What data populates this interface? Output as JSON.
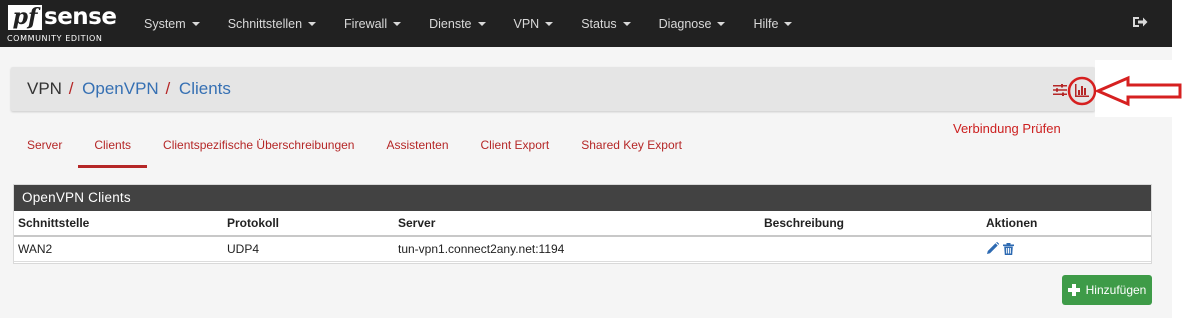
{
  "brand": {
    "logo_pf": "pf",
    "logo_sense": "sense",
    "edition": "COMMUNITY EDITION"
  },
  "nav": {
    "items": [
      {
        "label": "System"
      },
      {
        "label": "Schnittstellen"
      },
      {
        "label": "Firewall"
      },
      {
        "label": "Dienste"
      },
      {
        "label": "VPN"
      },
      {
        "label": "Status"
      },
      {
        "label": "Diagnose"
      },
      {
        "label": "Hilfe"
      }
    ],
    "logout_icon": "sign-out-icon"
  },
  "breadcrumb": {
    "root": "VPN",
    "section": "OpenVPN",
    "page": "Clients",
    "separator": "/"
  },
  "breadcrumb_icons": [
    "sliders-icon",
    "bar-chart-icon"
  ],
  "annotation": {
    "text": "Verbindung Prüfen",
    "color": "#cc1f1f"
  },
  "tabs": [
    {
      "label": "Server",
      "active": false
    },
    {
      "label": "Clients",
      "active": true
    },
    {
      "label": "Clientspezifische Überschreibungen",
      "active": false
    },
    {
      "label": "Assistenten",
      "active": false
    },
    {
      "label": "Client Export",
      "active": false
    },
    {
      "label": "Shared Key Export",
      "active": false
    }
  ],
  "panel": {
    "title": "OpenVPN Clients",
    "columns": [
      "Schnittstelle",
      "Protokoll",
      "Server",
      "Beschreibung",
      "Aktionen"
    ],
    "rows": [
      {
        "interface": "WAN2",
        "protocol": "UDP4",
        "server": "tun-vpn1.connect2any.net:1194",
        "description": "",
        "actions": [
          "edit-icon",
          "trash-icon"
        ]
      }
    ]
  },
  "add_button": {
    "label": "Hinzufügen",
    "icon": "plus-icon"
  },
  "colors": {
    "nav_bg": "#212121",
    "accent_red": "#b52727",
    "link_blue": "#3670b3",
    "panel_head": "#424242",
    "add_green": "#3e9b48"
  }
}
